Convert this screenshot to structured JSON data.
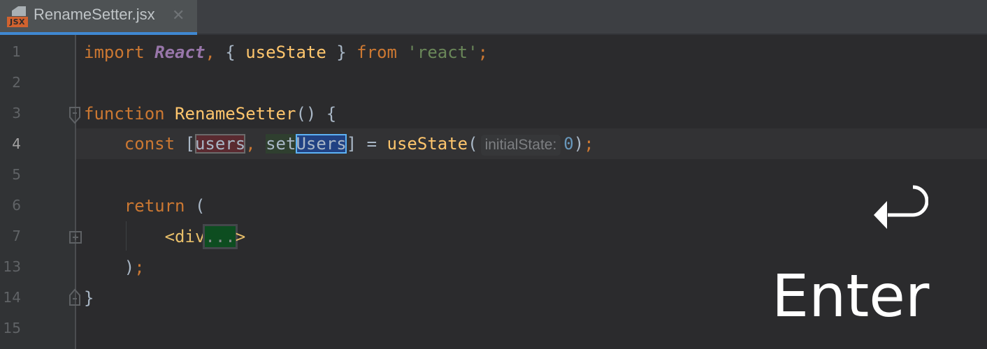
{
  "tab": {
    "file_badge": "JSX",
    "filename": "RenameSetter.jsx",
    "close_glyph": "✕",
    "icon": "jsx-file-icon"
  },
  "editor": {
    "current_line": "4",
    "line_numbers": [
      "1",
      "2",
      "3",
      "4",
      "5",
      "6",
      "7",
      "13",
      "14",
      "15"
    ],
    "lines": {
      "l1": {
        "import": "import",
        "react": "React",
        "comma": ",",
        "open": " { ",
        "usestate": "useState",
        "close": " } ",
        "from": "from",
        "space": " ",
        "module": "'react'",
        "semi": ";"
      },
      "l3": {
        "function": "function",
        "space": " ",
        "name": "RenameSetter",
        "rest": "() {"
      },
      "l4": {
        "indent": "    ",
        "const": "const",
        "open": " [",
        "users": "users",
        "comma": ",",
        "space": " ",
        "set": "set",
        "Users": "Users",
        "close": "] = ",
        "usestate": "useState",
        "paren": "(",
        "hint": "initialState:",
        "zero": "0",
        "close_paren": ")",
        "semi": ";"
      },
      "l6": {
        "indent": "    ",
        "return": "return",
        "rest": " ("
      },
      "l7": {
        "indent": "        ",
        "tag_open": "<div",
        "dots": "...",
        "tag_close": ">"
      },
      "l13": {
        "indent": "    ",
        "paren": ")",
        "semi": ";"
      },
      "l14": {
        "brace": "}"
      }
    }
  },
  "overlay": {
    "key_icon": "return-arrow-icon",
    "key_label": "Enter"
  },
  "colors": {
    "keyword": "#cc7832",
    "function": "#ffc66d",
    "string": "#6a8759",
    "number": "#6897bb",
    "tab_accent": "#3f88d2"
  }
}
